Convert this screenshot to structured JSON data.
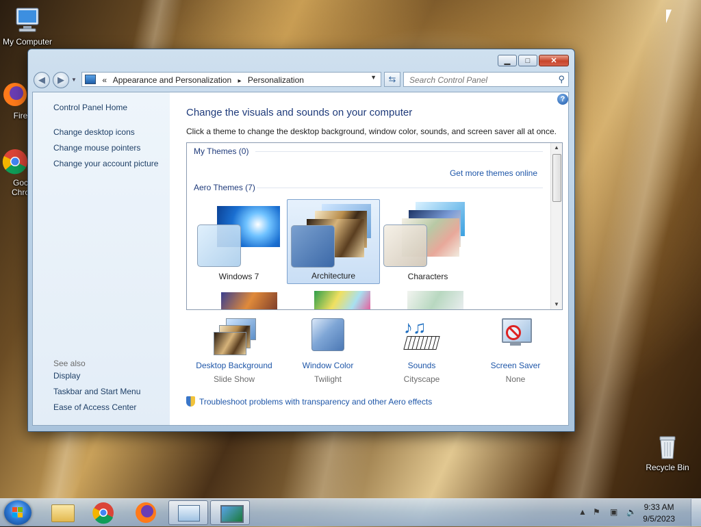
{
  "desktop": {
    "icons": [
      {
        "label": "My Computer"
      },
      {
        "label": "Fire"
      },
      {
        "label": "Goc"
      },
      {
        "label": "Chro"
      },
      {
        "label": "Recycle Bin"
      }
    ]
  },
  "window": {
    "caption_buttons": {
      "minimize": "▁",
      "maximize": "□",
      "close": "✕"
    },
    "address": {
      "prefix": "«",
      "crumbs": [
        "Appearance and Personalization",
        "Personalization"
      ],
      "separator": "▸"
    },
    "search": {
      "placeholder": "Search Control Panel"
    },
    "left_nav": {
      "home": "Control Panel Home",
      "links": [
        "Change desktop icons",
        "Change mouse pointers",
        "Change your account picture"
      ],
      "see_also_title": "See also",
      "see_also": [
        "Display",
        "Taskbar and Start Menu",
        "Ease of Access Center"
      ]
    },
    "main": {
      "heading": "Change the visuals and sounds on your computer",
      "description": "Click a theme to change the desktop background, window color, sounds, and screen saver all at once.",
      "my_themes": "My Themes (0)",
      "get_more": "Get more themes online",
      "aero_themes": "Aero Themes (7)",
      "themes": [
        {
          "name": "Windows 7",
          "selected": false
        },
        {
          "name": "Architecture",
          "selected": true
        },
        {
          "name": "Characters",
          "selected": false
        }
      ],
      "tools": [
        {
          "label": "Desktop Background",
          "value": "Slide Show"
        },
        {
          "label": "Window Color",
          "value": "Twilight"
        },
        {
          "label": "Sounds",
          "value": "Cityscape"
        },
        {
          "label": "Screen Saver",
          "value": "None"
        }
      ],
      "troubleshoot": "Troubleshoot problems with transparency and other Aero effects"
    }
  },
  "taskbar": {
    "time": "9:33 AM",
    "date": "9/5/2023",
    "tray_arrow": "▲"
  },
  "colors": {
    "link": "#1e56a8",
    "heading": "#1e3a7a"
  }
}
